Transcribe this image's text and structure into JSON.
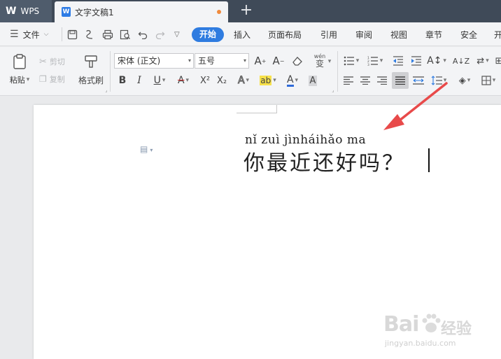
{
  "titlebar": {
    "app_logo": "W",
    "app_name": "WPS",
    "doc_icon": "W",
    "doc_title": "文字文稿1",
    "new_tab": "+"
  },
  "menubar": {
    "file_menu": "文件",
    "tabs": [
      "开始",
      "插入",
      "页面布局",
      "引用",
      "审阅",
      "视图",
      "章节",
      "安全",
      "开"
    ]
  },
  "toolbar": {
    "paste": "粘贴",
    "cut": "剪切",
    "copy": "复制",
    "format_painter": "格式刷",
    "font_name": "宋体 (正文)",
    "font_size": "五号",
    "pinyin_guide": "wén",
    "superscript": "X²",
    "subscript": "X₂"
  },
  "document": {
    "pinyin": "nǐ zuì jìnháihǎo ma",
    "text": "你最近还好吗？"
  },
  "colors": {
    "accent": "#2f7ce0",
    "titlebar": "#3f4a58",
    "annotation_arrow": "#e84a4a"
  },
  "watermark": {
    "logo": "Bai",
    "logo_tail": "经验",
    "url": "jingyan.baidu.com"
  }
}
